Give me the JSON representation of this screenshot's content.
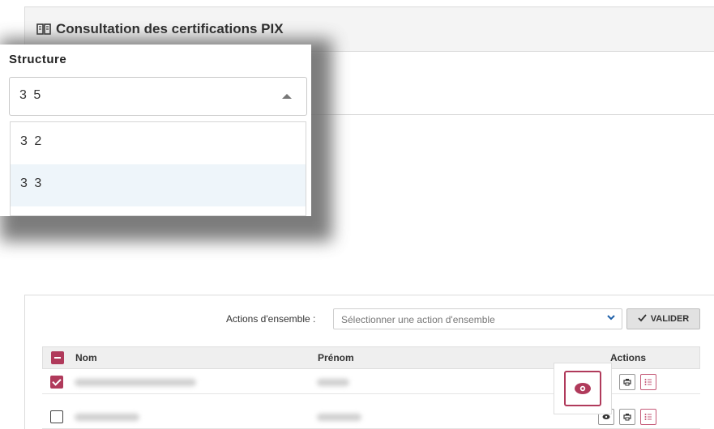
{
  "header": {
    "title": "Consultation des certifications PIX",
    "icon": "book-icon"
  },
  "structure_dropdown": {
    "label": "Structure",
    "selected": "3 5",
    "options": [
      "3 2",
      "3 3"
    ],
    "highlighted_option": "3 3"
  },
  "bulk_actions": {
    "label": "Actions d'ensemble :",
    "placeholder": "Sélectionner une action d'ensemble",
    "validate_label": "VALIDER"
  },
  "table": {
    "columns": {
      "nom": "Nom",
      "prenom": "Prénom",
      "actions": "Actions"
    },
    "rows": [
      {
        "checked": true
      },
      {
        "checked": false
      }
    ]
  },
  "colors": {
    "accent": "#b03a5b",
    "highlight_option": "#eef5fa"
  }
}
